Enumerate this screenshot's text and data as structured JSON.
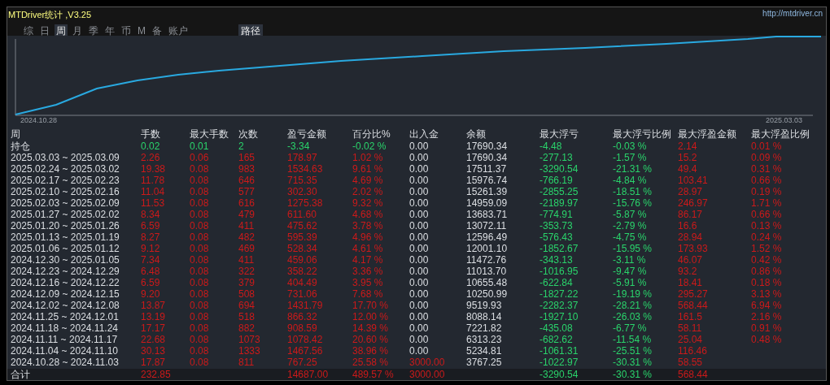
{
  "window": {
    "title": "MTDriver统计 ,V3.25",
    "url": "http://mtdriver.cn"
  },
  "tabs": [
    {
      "label": "综",
      "selected": false
    },
    {
      "label": "日",
      "selected": false
    },
    {
      "label": "周",
      "selected": true
    },
    {
      "label": "月",
      "selected": false
    },
    {
      "label": "季",
      "selected": false
    },
    {
      "label": "年",
      "selected": false
    },
    {
      "label": "币",
      "selected": false
    },
    {
      "label": "M",
      "selected": false
    },
    {
      "label": "备",
      "selected": false
    },
    {
      "label": "账户",
      "selected": false
    }
  ],
  "path_button": {
    "label": "路径"
  },
  "chart": {
    "start_label": "2024.10.28",
    "end_label": "2025.03.03"
  },
  "table": {
    "columns": [
      "周",
      "手数",
      "最大手数",
      "次数",
      "盈亏金额",
      "百分比%",
      "出入金",
      "余额",
      "最大浮亏",
      "最大浮亏比例",
      "最大浮盈金额",
      "最大浮盈比例"
    ],
    "rows": [
      {
        "cells": [
          {
            "text": "持仓"
          },
          {
            "text": "0.02",
            "color": "#2ad36b"
          },
          {
            "text": "0.01",
            "color": "#2ad36b"
          },
          {
            "text": "2",
            "color": "#2ad36b"
          },
          {
            "text": "-3.34",
            "color": "#2ad36b"
          },
          {
            "text": "-0.02 %",
            "color": "#2ad36b"
          },
          {
            "text": "0.00",
            "color": "#dcdfe3"
          },
          {
            "text": "17690.34",
            "color": "#dcdfe3"
          },
          {
            "text": "-4.48",
            "color": "#2ad36b"
          },
          {
            "text": "-0.03 %",
            "color": "#2ad36b"
          },
          {
            "text": "2.14",
            "color": "#cc1a1a"
          },
          {
            "text": "0.01 %",
            "color": "#cc1a1a"
          }
        ]
      },
      {
        "cells": [
          {
            "text": "2025.03.03 ~ 2025.03.09",
            "color": "#dcdfe3"
          },
          {
            "text": "2.26",
            "color": "#cc1a1a"
          },
          {
            "text": "0.06",
            "color": "#cc1a1a"
          },
          {
            "text": "165",
            "color": "#cc1a1a"
          },
          {
            "text": "178.97",
            "color": "#cc1a1a"
          },
          {
            "text": "1.02 %",
            "color": "#cc1a1a"
          },
          {
            "text": "0.00",
            "color": "#dcdfe3"
          },
          {
            "text": "17690.34",
            "color": "#dcdfe3"
          },
          {
            "text": "-277.13",
            "color": "#2ad36b"
          },
          {
            "text": "-1.57 %",
            "color": "#2ad36b"
          },
          {
            "text": "15.2",
            "color": "#cc1a1a"
          },
          {
            "text": "0.09 %",
            "color": "#cc1a1a"
          }
        ]
      },
      {
        "cells": [
          {
            "text": "2025.02.24 ~ 2025.03.02",
            "color": "#dcdfe3"
          },
          {
            "text": "19.38",
            "color": "#cc1a1a"
          },
          {
            "text": "0.08",
            "color": "#cc1a1a"
          },
          {
            "text": "983",
            "color": "#cc1a1a"
          },
          {
            "text": "1534.63",
            "color": "#cc1a1a"
          },
          {
            "text": "9.61 %",
            "color": "#cc1a1a"
          },
          {
            "text": "0.00",
            "color": "#dcdfe3"
          },
          {
            "text": "17511.37",
            "color": "#dcdfe3"
          },
          {
            "text": "-3290.54",
            "color": "#2ad36b"
          },
          {
            "text": "-21.31 %",
            "color": "#2ad36b"
          },
          {
            "text": "49.4",
            "color": "#cc1a1a"
          },
          {
            "text": "0.31 %",
            "color": "#cc1a1a"
          }
        ]
      },
      {
        "cells": [
          {
            "text": "2025.02.17 ~ 2025.02.23",
            "color": "#dcdfe3"
          },
          {
            "text": "11.78",
            "color": "#cc1a1a"
          },
          {
            "text": "0.08",
            "color": "#cc1a1a"
          },
          {
            "text": "646",
            "color": "#cc1a1a"
          },
          {
            "text": "715.35",
            "color": "#cc1a1a"
          },
          {
            "text": "4.69 %",
            "color": "#cc1a1a"
          },
          {
            "text": "0.00",
            "color": "#dcdfe3"
          },
          {
            "text": "15976.74",
            "color": "#dcdfe3"
          },
          {
            "text": "-766.19",
            "color": "#2ad36b"
          },
          {
            "text": "-4.84 %",
            "color": "#2ad36b"
          },
          {
            "text": "103.41",
            "color": "#cc1a1a"
          },
          {
            "text": "0.66 %",
            "color": "#cc1a1a"
          }
        ]
      },
      {
        "cells": [
          {
            "text": "2025.02.10 ~ 2025.02.16",
            "color": "#dcdfe3"
          },
          {
            "text": "11.04",
            "color": "#cc1a1a"
          },
          {
            "text": "0.08",
            "color": "#cc1a1a"
          },
          {
            "text": "577",
            "color": "#cc1a1a"
          },
          {
            "text": "302.30",
            "color": "#cc1a1a"
          },
          {
            "text": "2.02 %",
            "color": "#cc1a1a"
          },
          {
            "text": "0.00",
            "color": "#dcdfe3"
          },
          {
            "text": "15261.39",
            "color": "#dcdfe3"
          },
          {
            "text": "-2855.25",
            "color": "#2ad36b"
          },
          {
            "text": "-18.51 %",
            "color": "#2ad36b"
          },
          {
            "text": "28.97",
            "color": "#cc1a1a"
          },
          {
            "text": "0.19 %",
            "color": "#cc1a1a"
          }
        ]
      },
      {
        "cells": [
          {
            "text": "2025.02.03 ~ 2025.02.09",
            "color": "#dcdfe3"
          },
          {
            "text": "11.53",
            "color": "#cc1a1a"
          },
          {
            "text": "0.08",
            "color": "#cc1a1a"
          },
          {
            "text": "616",
            "color": "#cc1a1a"
          },
          {
            "text": "1275.38",
            "color": "#cc1a1a"
          },
          {
            "text": "9.32 %",
            "color": "#cc1a1a"
          },
          {
            "text": "0.00",
            "color": "#dcdfe3"
          },
          {
            "text": "14959.09",
            "color": "#dcdfe3"
          },
          {
            "text": "-2189.97",
            "color": "#2ad36b"
          },
          {
            "text": "-15.76 %",
            "color": "#2ad36b"
          },
          {
            "text": "246.97",
            "color": "#cc1a1a"
          },
          {
            "text": "1.71 %",
            "color": "#cc1a1a"
          }
        ]
      },
      {
        "cells": [
          {
            "text": "2025.01.27 ~ 2025.02.02",
            "color": "#dcdfe3"
          },
          {
            "text": "8.34",
            "color": "#cc1a1a"
          },
          {
            "text": "0.08",
            "color": "#cc1a1a"
          },
          {
            "text": "479",
            "color": "#cc1a1a"
          },
          {
            "text": "611.60",
            "color": "#cc1a1a"
          },
          {
            "text": "4.68 %",
            "color": "#cc1a1a"
          },
          {
            "text": "0.00",
            "color": "#dcdfe3"
          },
          {
            "text": "13683.71",
            "color": "#dcdfe3"
          },
          {
            "text": "-774.91",
            "color": "#2ad36b"
          },
          {
            "text": "-5.87 %",
            "color": "#2ad36b"
          },
          {
            "text": "86.17",
            "color": "#cc1a1a"
          },
          {
            "text": "0.66 %",
            "color": "#cc1a1a"
          }
        ]
      },
      {
        "cells": [
          {
            "text": "2025.01.20 ~ 2025.01.26",
            "color": "#dcdfe3"
          },
          {
            "text": "6.59",
            "color": "#cc1a1a"
          },
          {
            "text": "0.08",
            "color": "#cc1a1a"
          },
          {
            "text": "411",
            "color": "#cc1a1a"
          },
          {
            "text": "475.62",
            "color": "#cc1a1a"
          },
          {
            "text": "3.78 %",
            "color": "#cc1a1a"
          },
          {
            "text": "0.00",
            "color": "#dcdfe3"
          },
          {
            "text": "13072.11",
            "color": "#dcdfe3"
          },
          {
            "text": "-353.73",
            "color": "#2ad36b"
          },
          {
            "text": "-2.79 %",
            "color": "#2ad36b"
          },
          {
            "text": "16.6",
            "color": "#cc1a1a"
          },
          {
            "text": "0.13 %",
            "color": "#cc1a1a"
          }
        ]
      },
      {
        "cells": [
          {
            "text": "2025.01.13 ~ 2025.01.19",
            "color": "#dcdfe3"
          },
          {
            "text": "8.27",
            "color": "#cc1a1a"
          },
          {
            "text": "0.08",
            "color": "#cc1a1a"
          },
          {
            "text": "482",
            "color": "#cc1a1a"
          },
          {
            "text": "595.39",
            "color": "#cc1a1a"
          },
          {
            "text": "4.96 %",
            "color": "#cc1a1a"
          },
          {
            "text": "0.00",
            "color": "#dcdfe3"
          },
          {
            "text": "12596.49",
            "color": "#dcdfe3"
          },
          {
            "text": "-576.43",
            "color": "#2ad36b"
          },
          {
            "text": "-4.75 %",
            "color": "#2ad36b"
          },
          {
            "text": "28.94",
            "color": "#cc1a1a"
          },
          {
            "text": "0.24 %",
            "color": "#cc1a1a"
          }
        ]
      },
      {
        "cells": [
          {
            "text": "2025.01.06 ~ 2025.01.12",
            "color": "#dcdfe3"
          },
          {
            "text": "9.12",
            "color": "#cc1a1a"
          },
          {
            "text": "0.08",
            "color": "#cc1a1a"
          },
          {
            "text": "469",
            "color": "#cc1a1a"
          },
          {
            "text": "528.34",
            "color": "#cc1a1a"
          },
          {
            "text": "4.61 %",
            "color": "#cc1a1a"
          },
          {
            "text": "0.00",
            "color": "#dcdfe3"
          },
          {
            "text": "12001.10",
            "color": "#dcdfe3"
          },
          {
            "text": "-1852.67",
            "color": "#2ad36b"
          },
          {
            "text": "-15.95 %",
            "color": "#2ad36b"
          },
          {
            "text": "173.93",
            "color": "#cc1a1a"
          },
          {
            "text": "1.52 %",
            "color": "#cc1a1a"
          }
        ]
      },
      {
        "cells": [
          {
            "text": "2024.12.30 ~ 2025.01.05",
            "color": "#dcdfe3"
          },
          {
            "text": "7.34",
            "color": "#cc1a1a"
          },
          {
            "text": "0.08",
            "color": "#cc1a1a"
          },
          {
            "text": "411",
            "color": "#cc1a1a"
          },
          {
            "text": "459.06",
            "color": "#cc1a1a"
          },
          {
            "text": "4.17 %",
            "color": "#cc1a1a"
          },
          {
            "text": "0.00",
            "color": "#dcdfe3"
          },
          {
            "text": "11472.76",
            "color": "#dcdfe3"
          },
          {
            "text": "-343.13",
            "color": "#2ad36b"
          },
          {
            "text": "-3.11 %",
            "color": "#2ad36b"
          },
          {
            "text": "46.07",
            "color": "#cc1a1a"
          },
          {
            "text": "0.42 %",
            "color": "#cc1a1a"
          }
        ]
      },
      {
        "cells": [
          {
            "text": "2024.12.23 ~ 2024.12.29",
            "color": "#dcdfe3"
          },
          {
            "text": "6.48",
            "color": "#cc1a1a"
          },
          {
            "text": "0.08",
            "color": "#cc1a1a"
          },
          {
            "text": "322",
            "color": "#cc1a1a"
          },
          {
            "text": "358.22",
            "color": "#cc1a1a"
          },
          {
            "text": "3.36 %",
            "color": "#cc1a1a"
          },
          {
            "text": "0.00",
            "color": "#dcdfe3"
          },
          {
            "text": "11013.70",
            "color": "#dcdfe3"
          },
          {
            "text": "-1016.95",
            "color": "#2ad36b"
          },
          {
            "text": "-9.47 %",
            "color": "#2ad36b"
          },
          {
            "text": "93.2",
            "color": "#cc1a1a"
          },
          {
            "text": "0.86 %",
            "color": "#cc1a1a"
          }
        ]
      },
      {
        "cells": [
          {
            "text": "2024.12.16 ~ 2024.12.22",
            "color": "#dcdfe3"
          },
          {
            "text": "6.59",
            "color": "#cc1a1a"
          },
          {
            "text": "0.08",
            "color": "#cc1a1a"
          },
          {
            "text": "379",
            "color": "#cc1a1a"
          },
          {
            "text": "404.49",
            "color": "#cc1a1a"
          },
          {
            "text": "3.95 %",
            "color": "#cc1a1a"
          },
          {
            "text": "0.00",
            "color": "#dcdfe3"
          },
          {
            "text": "10655.48",
            "color": "#dcdfe3"
          },
          {
            "text": "-622.84",
            "color": "#2ad36b"
          },
          {
            "text": "-5.91 %",
            "color": "#2ad36b"
          },
          {
            "text": "18.41",
            "color": "#cc1a1a"
          },
          {
            "text": "0.18 %",
            "color": "#cc1a1a"
          }
        ]
      },
      {
        "cells": [
          {
            "text": "2024.12.09 ~ 2024.12.15",
            "color": "#dcdfe3"
          },
          {
            "text": "9.20",
            "color": "#cc1a1a"
          },
          {
            "text": "0.08",
            "color": "#cc1a1a"
          },
          {
            "text": "508",
            "color": "#cc1a1a"
          },
          {
            "text": "731.06",
            "color": "#cc1a1a"
          },
          {
            "text": "7.68 %",
            "color": "#cc1a1a"
          },
          {
            "text": "0.00",
            "color": "#dcdfe3"
          },
          {
            "text": "10250.99",
            "color": "#dcdfe3"
          },
          {
            "text": "-1827.22",
            "color": "#2ad36b"
          },
          {
            "text": "-19.19 %",
            "color": "#2ad36b"
          },
          {
            "text": "295.27",
            "color": "#cc1a1a"
          },
          {
            "text": "3.13 %",
            "color": "#cc1a1a"
          }
        ]
      },
      {
        "cells": [
          {
            "text": "2024.12.02 ~ 2024.12.08",
            "color": "#dcdfe3"
          },
          {
            "text": "13.87",
            "color": "#cc1a1a"
          },
          {
            "text": "0.08",
            "color": "#cc1a1a"
          },
          {
            "text": "694",
            "color": "#cc1a1a"
          },
          {
            "text": "1431.79",
            "color": "#cc1a1a"
          },
          {
            "text": "17.70 %",
            "color": "#cc1a1a"
          },
          {
            "text": "0.00",
            "color": "#dcdfe3"
          },
          {
            "text": "9519.93",
            "color": "#dcdfe3"
          },
          {
            "text": "-2282.37",
            "color": "#2ad36b"
          },
          {
            "text": "-28.21 %",
            "color": "#2ad36b"
          },
          {
            "text": "568.44",
            "color": "#cc1a1a"
          },
          {
            "text": "6.94 %",
            "color": "#cc1a1a"
          }
        ]
      },
      {
        "cells": [
          {
            "text": "2024.11.25 ~ 2024.12.01",
            "color": "#dcdfe3"
          },
          {
            "text": "13.19",
            "color": "#cc1a1a"
          },
          {
            "text": "0.08",
            "color": "#cc1a1a"
          },
          {
            "text": "518",
            "color": "#cc1a1a"
          },
          {
            "text": "866.32",
            "color": "#cc1a1a"
          },
          {
            "text": "12.00 %",
            "color": "#cc1a1a"
          },
          {
            "text": "0.00",
            "color": "#dcdfe3"
          },
          {
            "text": "8088.14",
            "color": "#dcdfe3"
          },
          {
            "text": "-1927.10",
            "color": "#2ad36b"
          },
          {
            "text": "-26.03 %",
            "color": "#2ad36b"
          },
          {
            "text": "161.5",
            "color": "#cc1a1a"
          },
          {
            "text": "2.16 %",
            "color": "#cc1a1a"
          }
        ]
      },
      {
        "cells": [
          {
            "text": "2024.11.18 ~ 2024.11.24",
            "color": "#dcdfe3"
          },
          {
            "text": "17.17",
            "color": "#cc1a1a"
          },
          {
            "text": "0.08",
            "color": "#cc1a1a"
          },
          {
            "text": "882",
            "color": "#cc1a1a"
          },
          {
            "text": "908.59",
            "color": "#cc1a1a"
          },
          {
            "text": "14.39 %",
            "color": "#cc1a1a"
          },
          {
            "text": "0.00",
            "color": "#dcdfe3"
          },
          {
            "text": "7221.82",
            "color": "#dcdfe3"
          },
          {
            "text": "-435.08",
            "color": "#2ad36b"
          },
          {
            "text": "-6.77 %",
            "color": "#2ad36b"
          },
          {
            "text": "58.11",
            "color": "#cc1a1a"
          },
          {
            "text": "0.91 %",
            "color": "#cc1a1a"
          }
        ]
      },
      {
        "cells": [
          {
            "text": "2024.11.11 ~ 2024.11.17",
            "color": "#dcdfe3"
          },
          {
            "text": "22.68",
            "color": "#cc1a1a"
          },
          {
            "text": "0.08",
            "color": "#cc1a1a"
          },
          {
            "text": "1073",
            "color": "#cc1a1a"
          },
          {
            "text": "1078.42",
            "color": "#cc1a1a"
          },
          {
            "text": "20.60 %",
            "color": "#cc1a1a"
          },
          {
            "text": "0.00",
            "color": "#dcdfe3"
          },
          {
            "text": "6313.23",
            "color": "#dcdfe3"
          },
          {
            "text": "-682.62",
            "color": "#2ad36b"
          },
          {
            "text": "-11.54 %",
            "color": "#2ad36b"
          },
          {
            "text": "25.04",
            "color": "#cc1a1a"
          },
          {
            "text": "0.48 %",
            "color": "#cc1a1a"
          }
        ]
      },
      {
        "cells": [
          {
            "text": "2024.11.04 ~ 2024.11.10",
            "color": "#dcdfe3"
          },
          {
            "text": "30.13",
            "color": "#cc1a1a"
          },
          {
            "text": "0.08",
            "color": "#cc1a1a"
          },
          {
            "text": "1333",
            "color": "#cc1a1a"
          },
          {
            "text": "1467.56",
            "color": "#cc1a1a"
          },
          {
            "text": "38.96 %",
            "color": "#cc1a1a"
          },
          {
            "text": "0.00",
            "color": "#dcdfe3"
          },
          {
            "text": "5234.81",
            "color": "#dcdfe3"
          },
          {
            "text": "-1061.31",
            "color": "#2ad36b"
          },
          {
            "text": "-25.51 %",
            "color": "#2ad36b"
          },
          {
            "text": "116.46",
            "color": "#cc1a1a"
          },
          null
        ]
      },
      {
        "cells": [
          {
            "text": "2024.10.28 ~ 2024.11.03",
            "color": "#dcdfe3"
          },
          {
            "text": "17.87",
            "color": "#cc1a1a"
          },
          {
            "text": "0.08",
            "color": "#cc1a1a"
          },
          {
            "text": "811",
            "color": "#cc1a1a"
          },
          {
            "text": "767.25",
            "color": "#cc1a1a"
          },
          {
            "text": "25.58 %",
            "color": "#cc1a1a"
          },
          {
            "text": "3000.00",
            "color": "#cc1a1a"
          },
          {
            "text": "3767.25",
            "color": "#dcdfe3"
          },
          {
            "text": "-1022.97",
            "color": "#2ad36b"
          },
          {
            "text": "-30.31 %",
            "color": "#2ad36b"
          },
          {
            "text": "58.55",
            "color": "#cc1a1a"
          },
          null
        ]
      }
    ],
    "total": {
      "cells": [
        {
          "text": "合计"
        },
        {
          "text": "232.85",
          "color": "#cc1a1a"
        },
        null,
        null,
        {
          "text": "14687.00",
          "color": "#cc1a1a"
        },
        {
          "text": "489.57 %",
          "color": "#cc1a1a"
        },
        {
          "text": "3000.00",
          "color": "#cc1a1a"
        },
        null,
        {
          "text": "-3290.54",
          "color": "#2ad36b"
        },
        {
          "text": "-30.31 %",
          "color": "#2ad36b"
        },
        {
          "text": "568.44",
          "color": "#cc1a1a"
        },
        null
      ]
    }
  }
}
